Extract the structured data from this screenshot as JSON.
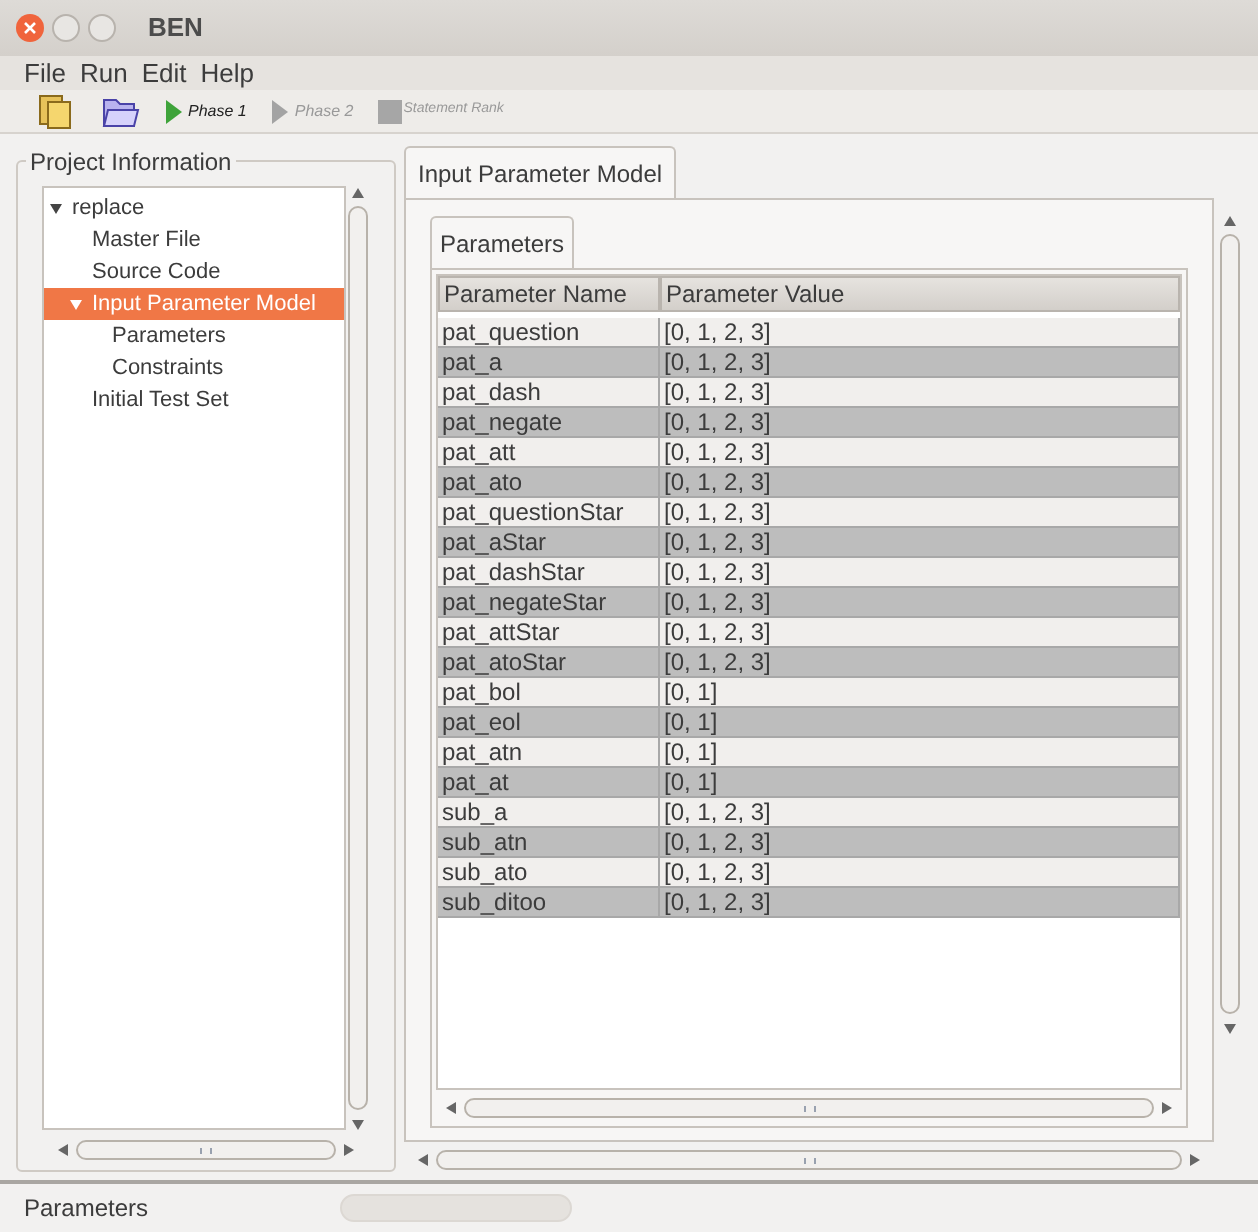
{
  "window": {
    "title": "BEN"
  },
  "menu": [
    "File",
    "Run",
    "Edit",
    "Help"
  ],
  "toolbar": [
    {
      "kind": "new"
    },
    {
      "kind": "open"
    },
    {
      "kind": "phase",
      "label": "Phase 1",
      "disabled": false
    },
    {
      "kind": "phase",
      "label": "Phase 2",
      "disabled": true
    },
    {
      "kind": "rank",
      "label": "Statement Rank",
      "disabled": true
    }
  ],
  "project_panel": {
    "title": "Project Information",
    "tree": [
      {
        "label": "replace",
        "expanded": true,
        "selected": false,
        "children": [
          {
            "label": "Master File",
            "selected": false
          },
          {
            "label": "Source Code",
            "selected": false
          },
          {
            "label": "Input Parameter Model",
            "expanded": true,
            "selected": true,
            "children": [
              {
                "label": "Parameters",
                "selected": false
              },
              {
                "label": "Constraints",
                "selected": false
              }
            ]
          },
          {
            "label": "Initial Test Set",
            "selected": false
          }
        ]
      }
    ]
  },
  "tabs": [
    {
      "label": "Input Parameter Model",
      "selected": true
    }
  ],
  "inner_tabs": [
    {
      "label": "Parameters",
      "selected": true
    }
  ],
  "table": {
    "columns": [
      "Parameter Name",
      "Parameter Value"
    ],
    "rows": [
      [
        "pat_question",
        "[0, 1, 2, 3]"
      ],
      [
        "pat_a",
        "[0, 1, 2, 3]"
      ],
      [
        "pat_dash",
        "[0, 1, 2, 3]"
      ],
      [
        "pat_negate",
        "[0, 1, 2, 3]"
      ],
      [
        "pat_att",
        "[0, 1, 2, 3]"
      ],
      [
        "pat_ato",
        "[0, 1, 2, 3]"
      ],
      [
        "pat_questionStar",
        "[0, 1, 2, 3]"
      ],
      [
        "pat_aStar",
        "[0, 1, 2, 3]"
      ],
      [
        "pat_dashStar",
        "[0, 1, 2, 3]"
      ],
      [
        "pat_negateStar",
        "[0, 1, 2, 3]"
      ],
      [
        "pat_attStar",
        "[0, 1, 2, 3]"
      ],
      [
        "pat_atoStar",
        "[0, 1, 2, 3]"
      ],
      [
        "pat_bol",
        "[0, 1]"
      ],
      [
        "pat_eol",
        "[0, 1]"
      ],
      [
        "pat_atn",
        "[0, 1]"
      ],
      [
        "pat_at",
        "[0, 1]"
      ],
      [
        "sub_a",
        "[0, 1, 2, 3]"
      ],
      [
        "sub_atn",
        "[0, 1, 2, 3]"
      ],
      [
        "sub_ato",
        "[0, 1, 2, 3]"
      ],
      [
        "sub_ditoo",
        "[0, 1, 2, 3]"
      ]
    ]
  },
  "status_bar": {
    "text": "Parameters"
  }
}
